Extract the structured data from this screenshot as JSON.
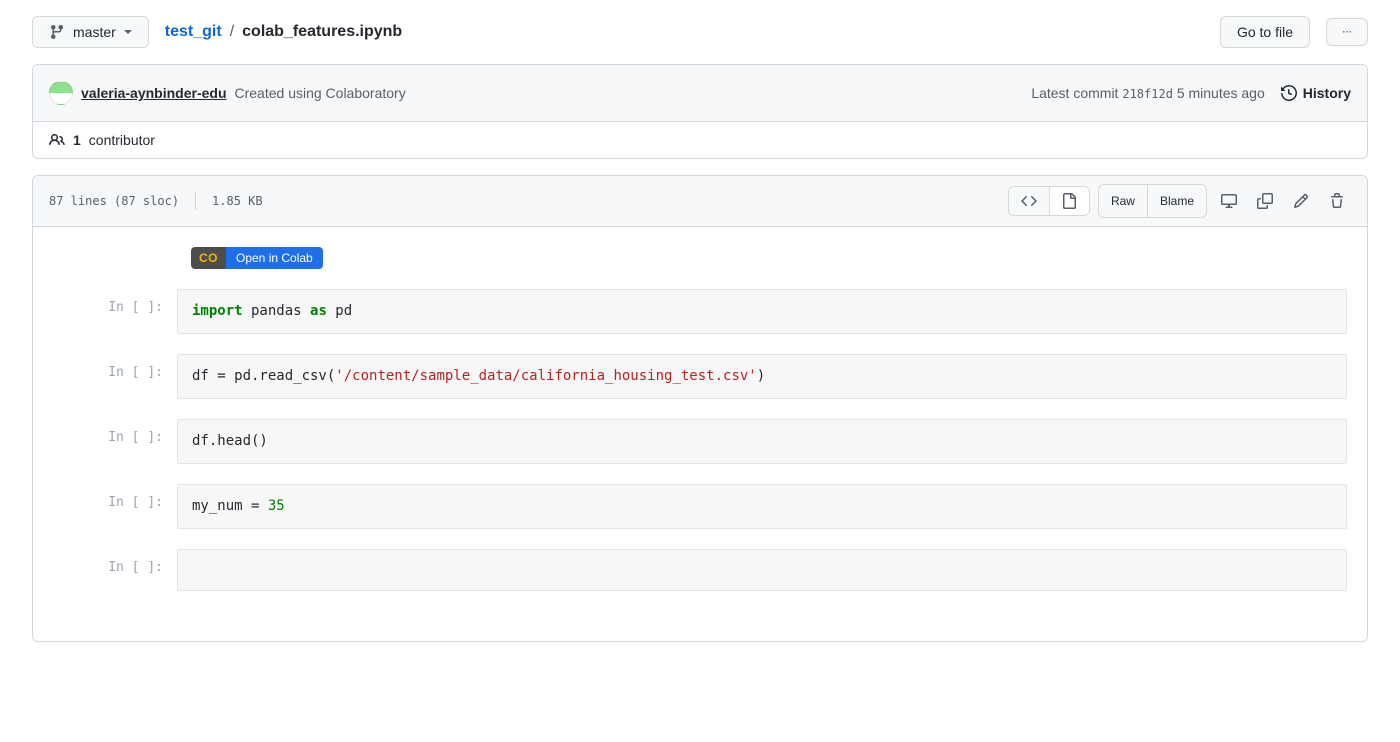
{
  "branch": {
    "label": "master"
  },
  "breadcrumb": {
    "repo": "test_git",
    "sep": "/",
    "file": "colab_features.ipynb"
  },
  "header_actions": {
    "goto_file": "Go to file"
  },
  "commit": {
    "author": "valeria-aynbinder-edu",
    "message": "Created using Colaboratory",
    "latest_label": "Latest commit",
    "sha": "218f12d",
    "time": "5 minutes ago",
    "history_label": "History"
  },
  "contributors": {
    "count": "1",
    "label": "contributor"
  },
  "file_meta": {
    "lines": "87 lines (87 sloc)",
    "size": "1.85 KB"
  },
  "file_actions": {
    "raw": "Raw",
    "blame": "Blame"
  },
  "colab_badge": {
    "left": "CO",
    "right": "Open in Colab"
  },
  "notebook": {
    "prompt": "In [ ]:",
    "cells": [
      {
        "tokens": [
          {
            "t": "import",
            "c": "tok-kw"
          },
          {
            "t": " pandas "
          },
          {
            "t": "as",
            "c": "tok-kw"
          },
          {
            "t": " pd"
          }
        ]
      },
      {
        "tokens": [
          {
            "t": "df = pd.read_csv("
          },
          {
            "t": "'/content/sample_data/california_housing_test.csv'",
            "c": "tok-str"
          },
          {
            "t": ")"
          }
        ]
      },
      {
        "tokens": [
          {
            "t": "df.head()"
          }
        ]
      },
      {
        "tokens": [
          {
            "t": "my_num = "
          },
          {
            "t": "35",
            "c": "tok-num"
          }
        ]
      },
      {
        "tokens": []
      }
    ]
  }
}
